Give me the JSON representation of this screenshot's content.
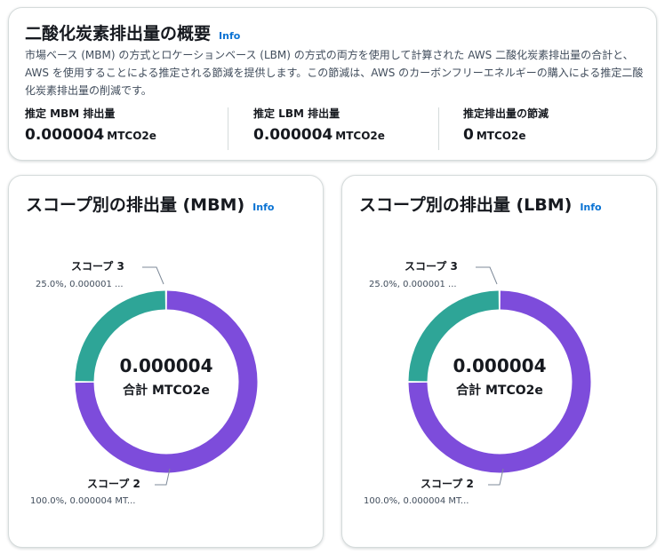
{
  "overview": {
    "title": "二酸化炭素排出量の概要",
    "info": "Info",
    "description": "市場ベース (MBM) の方式とロケーションベース (LBM) の方式の両方を使用して計算された AWS 二酸化炭素排出量の合計と、AWS を使用することによる推定される節減を提供します。この節減は、AWS のカーボンフリーエネルギーの購入による推定二酸化炭素排出量の削減です。",
    "metrics": [
      {
        "label": "推定 MBM 排出量",
        "value": "0.000004",
        "unit": "MTCO2e"
      },
      {
        "label": "推定 LBM 排出量",
        "value": "0.000004",
        "unit": "MTCO2e"
      },
      {
        "label": "推定排出量の節減",
        "value": "0",
        "unit": "MTCO2e"
      }
    ]
  },
  "mbm": {
    "title": "スコープ別の排出量 (MBM)",
    "info": "Info",
    "total": "0.000004",
    "total_label": "合計 MTCO2e",
    "segments": [
      {
        "name": "スコープ 3",
        "detail": "25.0%, 0.000001 ...",
        "share": 0.25,
        "color": "#2ea597"
      },
      {
        "name": "スコープ 2",
        "detail": "100.0%, 0.000004 MT...",
        "share": 0.75,
        "color": "#7d4cdb"
      }
    ]
  },
  "lbm": {
    "title": "スコープ別の排出量 (LBM)",
    "info": "Info",
    "total": "0.000004",
    "total_label": "合計 MTCO2e",
    "segments": [
      {
        "name": "スコープ 3",
        "detail": "25.0%, 0.000001 ...",
        "share": 0.25,
        "color": "#2ea597"
      },
      {
        "name": "スコープ 2",
        "detail": "100.0%, 0.000004 MT...",
        "share": 0.75,
        "color": "#7d4cdb"
      }
    ]
  },
  "chart_data": [
    {
      "type": "pie",
      "title": "スコープ別の排出量 (MBM)",
      "categories": [
        "スコープ 3",
        "スコープ 2"
      ],
      "values": [
        1e-06,
        4e-06
      ],
      "labels": [
        "25.0%, 0.000001 ...",
        "100.0%, 0.000004 MT..."
      ],
      "center_value": "0.000004",
      "center_label": "合計 MTCO2e"
    },
    {
      "type": "pie",
      "title": "スコープ別の排出量 (LBM)",
      "categories": [
        "スコープ 3",
        "スコープ 2"
      ],
      "values": [
        1e-06,
        4e-06
      ],
      "labels": [
        "25.0%, 0.000001 ...",
        "100.0%, 0.000004 MT..."
      ],
      "center_value": "0.000004",
      "center_label": "合計 MTCO2e"
    }
  ]
}
